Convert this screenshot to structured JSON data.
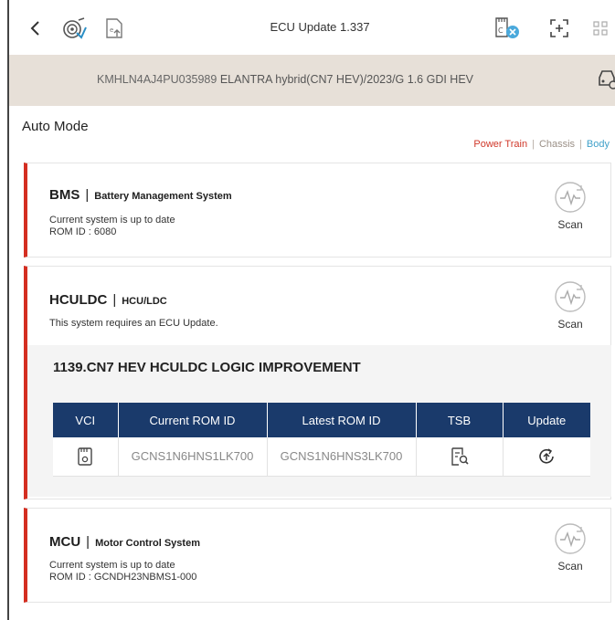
{
  "header": {
    "title": "ECU Update 1.337"
  },
  "vehicle": {
    "vin": "KMHLN4AJ4PU035989",
    "model": "ELANTRA hybrid(CN7 HEV)/2023/G 1.6 GDI HEV"
  },
  "mode": {
    "title": "Auto Mode",
    "filters": [
      "Power Train",
      "Chassis",
      "Body"
    ]
  },
  "systems": [
    {
      "code": "BMS",
      "name": "Battery Management System",
      "status": "Current system is up to date",
      "rom": "ROM ID : 6080",
      "scan_label": "Scan"
    },
    {
      "code": "HCULDC",
      "name": "HCU/LDC",
      "status": "This system requires an ECU Update.",
      "scan_label": "Scan",
      "update": {
        "title": "1139.CN7 HEV HCULDC LOGIC IMPROVEMENT",
        "columns": [
          "VCI",
          "Current ROM ID",
          "Latest ROM ID",
          "TSB",
          "Update"
        ],
        "row": {
          "current_rom": "GCNS1N6HNS1LK700",
          "latest_rom": "GCNS1N6HNS3LK700"
        }
      }
    },
    {
      "code": "MCU",
      "name": "Motor Control System",
      "status": "Current system is up to date",
      "rom": "ROM ID : GCNDH23NBMS1-000",
      "scan_label": "Scan"
    }
  ],
  "colors": {
    "accent_red": "#d42e21",
    "table_header": "#1a3a6b",
    "latest_rom": "#1d9fb4",
    "vehicle_bar": "#e7e0d8",
    "filter_chassis": "#9a8f86",
    "filter_body": "#3fa0c9"
  }
}
